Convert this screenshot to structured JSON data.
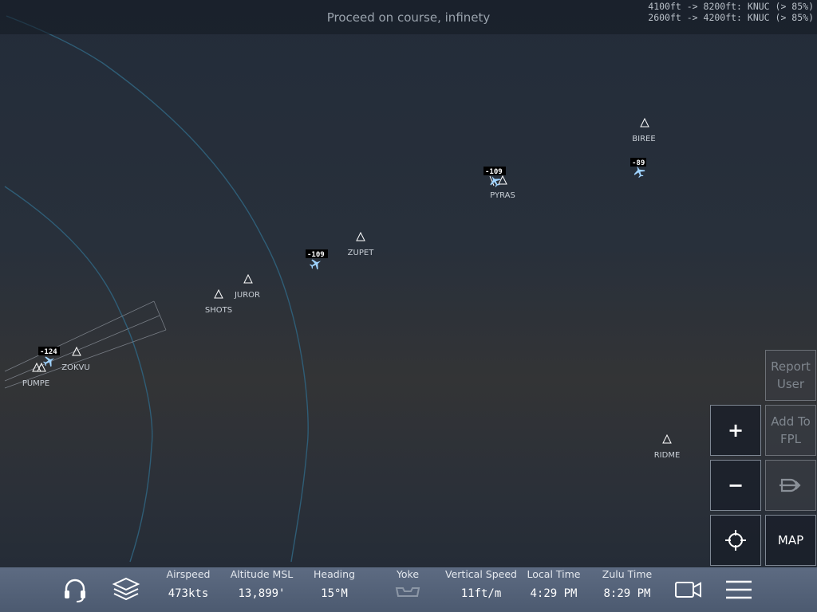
{
  "top": {
    "atc_message": "Proceed on course, infinety",
    "altitude_clearances": [
      "4100ft -> 8200ft: KNUC (> 85%)",
      "2600ft -> 4200ft: KNUC (> 85%)"
    ]
  },
  "map": {
    "waypoints": [
      "BIREE",
      "PYRAS",
      "ZUPET",
      "JUROR",
      "SHOTS",
      "ZOKVU",
      "PUMPE",
      "RIDME"
    ],
    "traffic": [
      "-89",
      "-109",
      "-109",
      "-124"
    ]
  },
  "side_buttons": {
    "report_user": "Report\nUser",
    "add_to_fpl": "Add To\nFPL",
    "zoom_in": "+",
    "zoom_out": "−",
    "map": "MAP"
  },
  "stats": {
    "airspeed": {
      "label": "Airspeed",
      "value": "473kts"
    },
    "altitude": {
      "label": "Altitude MSL",
      "value": "13,899'"
    },
    "heading": {
      "label": "Heading",
      "value": "15°M"
    },
    "yoke": {
      "label": "Yoke"
    },
    "vertical_speed": {
      "label": "Vertical Speed",
      "value": "11ft/m"
    },
    "local_time": {
      "label": "Local Time",
      "value": "4:29 PM"
    },
    "zulu_time": {
      "label": "Zulu Time",
      "value": "8:29 PM"
    }
  },
  "icons": {
    "atc": "headset-icon",
    "layers": "layers-icon",
    "yoke": "yoke-icon",
    "camera": "video-camera-icon",
    "menu": "hamburger-menu-icon",
    "recenter": "crosshair-icon",
    "direct_to": "direct-to-icon"
  },
  "colors": {
    "airspace_line": "#2f5d76",
    "bottom_bar": "#566479",
    "aircraft": "#9fd3ff"
  }
}
